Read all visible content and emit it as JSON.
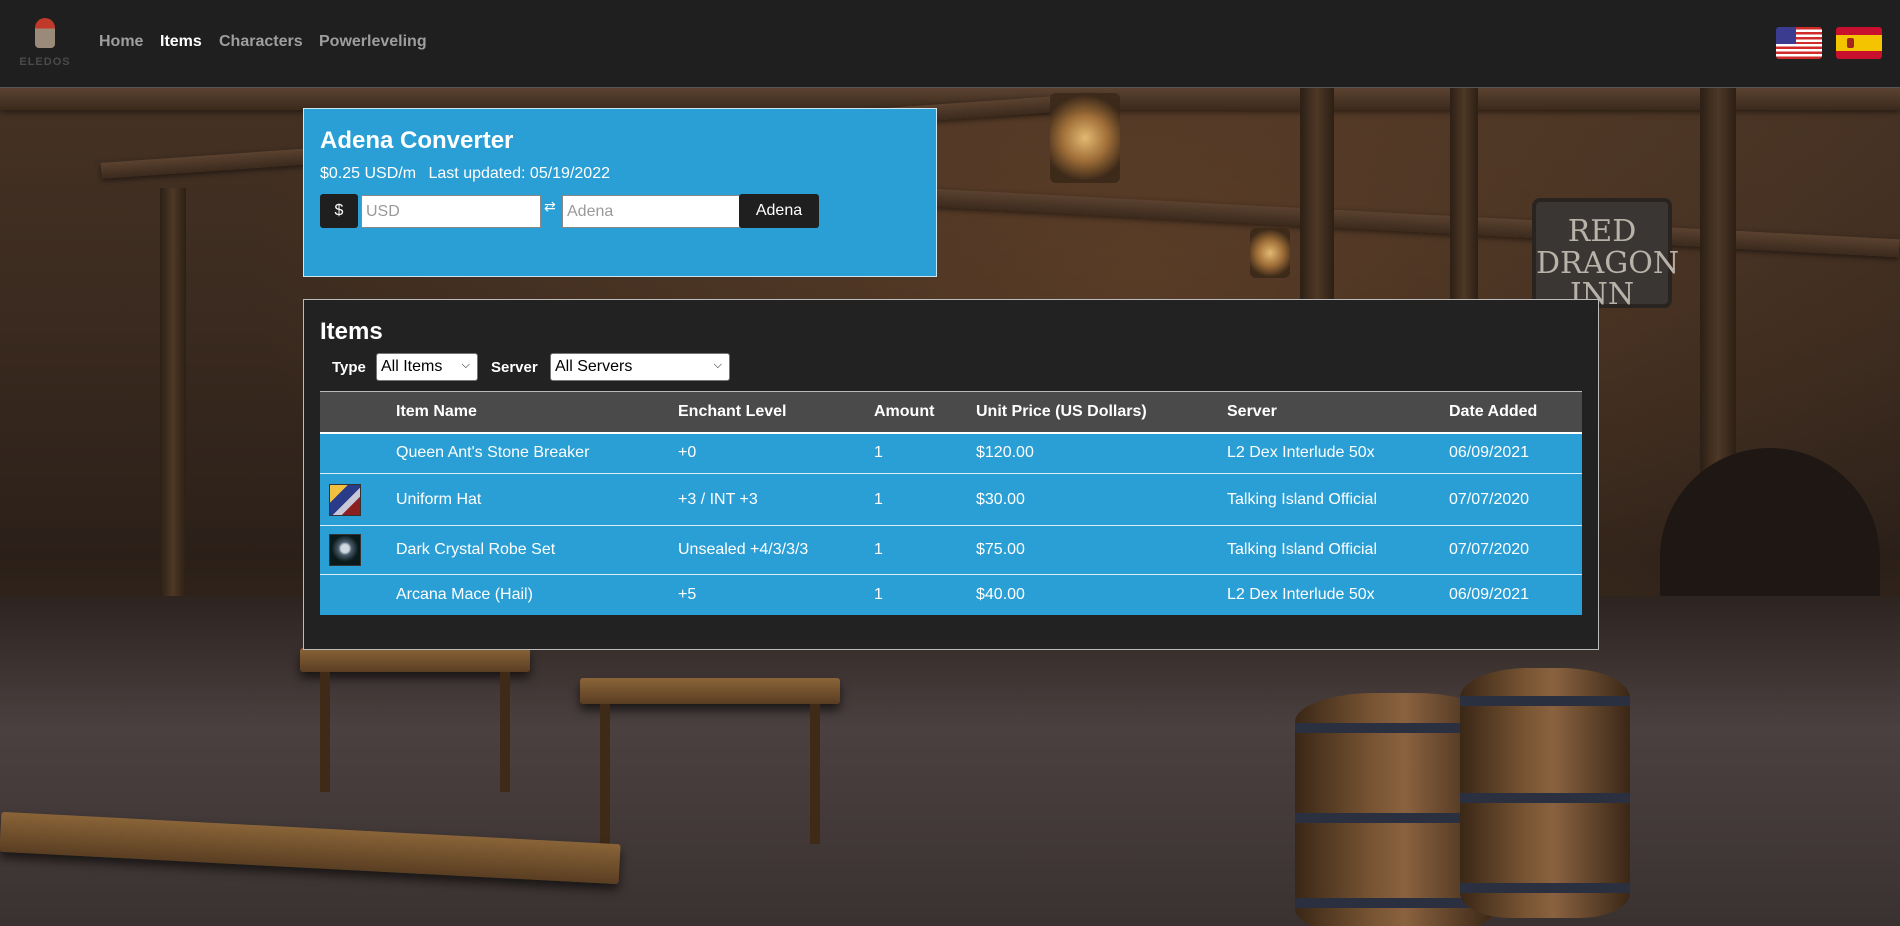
{
  "nav": {
    "logo_text": "ELEDOS",
    "links": [
      "Home",
      "Items",
      "Characters",
      "Powerleveling"
    ],
    "active": "Items"
  },
  "backdrop": {
    "sign_text": [
      "RED",
      "DRAGON",
      "INN"
    ]
  },
  "converter": {
    "title": "Adena Converter",
    "rate": "$0.25 USD/m",
    "updated": "Last updated: 05/19/2022",
    "currency_symbol": "$",
    "usd_placeholder": "USD",
    "swap_glyph": "⇄",
    "adena_placeholder": "Adena",
    "adena_button": "Adena"
  },
  "items": {
    "title": "Items",
    "type_label": "Type",
    "type_value": "All Items",
    "server_label": "Server",
    "server_value": "All Servers",
    "columns": [
      "",
      "Item Name",
      "Enchant Level",
      "Amount",
      "Unit Price (US Dollars)",
      "Server",
      "Date Added"
    ],
    "rows": [
      {
        "thumb": "",
        "name": "Queen Ant's Stone Breaker",
        "enchant": "+0",
        "amount": "1",
        "price": "$120.00",
        "server": "L2 Dex Interlude 50x",
        "date": "06/09/2021"
      },
      {
        "thumb": "uniform-hat-icon",
        "name": "Uniform Hat",
        "enchant": "+3 / INT +3",
        "amount": "1",
        "price": "$30.00",
        "server": "Talking Island Official",
        "date": "07/07/2020"
      },
      {
        "thumb": "dark-crystal-robe-icon",
        "name": "Dark Crystal Robe Set",
        "enchant": "Unsealed +4/3/3/3",
        "amount": "1",
        "price": "$75.00",
        "server": "Talking Island Official",
        "date": "07/07/2020"
      },
      {
        "thumb": "",
        "name": "Arcana Mace (Hail)",
        "enchant": "+5",
        "amount": "1",
        "price": "$40.00",
        "server": "L2 Dex Interlude 50x",
        "date": "06/09/2021"
      }
    ]
  }
}
